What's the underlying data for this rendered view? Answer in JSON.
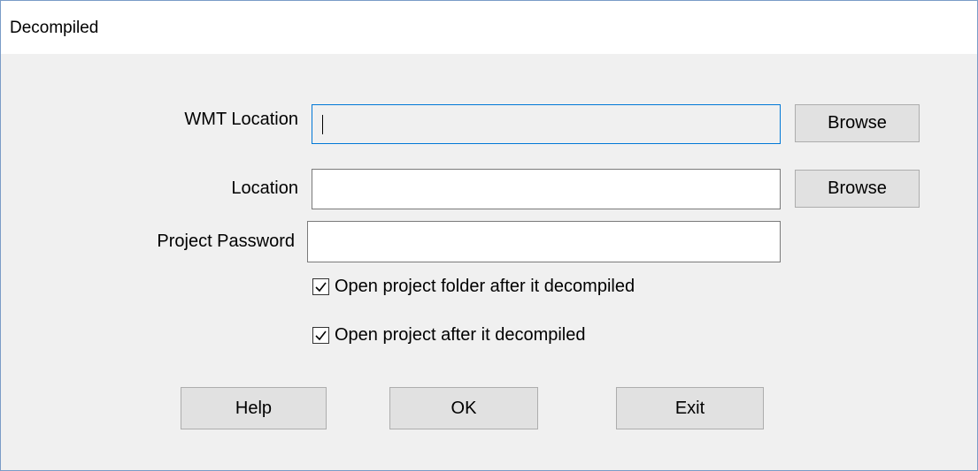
{
  "window": {
    "title": "Decompiled"
  },
  "form": {
    "wmt_location": {
      "label": "WMT Location",
      "value": "",
      "browse_label": "Browse"
    },
    "location": {
      "label": "Location",
      "value": "",
      "browse_label": "Browse"
    },
    "project_password": {
      "label": "Project Password",
      "value": ""
    },
    "options": [
      {
        "label": "Open project folder after it decompiled",
        "checked": true
      },
      {
        "label": "Open project after it decompiled",
        "checked": true
      }
    ]
  },
  "buttons": {
    "help": "Help",
    "ok": "OK",
    "exit": "Exit"
  },
  "icons": {
    "checkbox_check": "check-icon"
  }
}
